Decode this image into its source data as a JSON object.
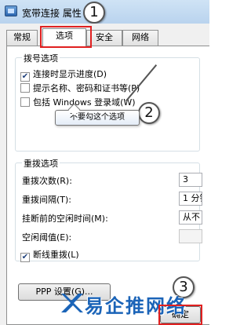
{
  "window": {
    "title": "宽带连接 属性"
  },
  "tabs": [
    {
      "label": "常规"
    },
    {
      "label": "选项"
    },
    {
      "label": "安全"
    },
    {
      "label": "网络"
    }
  ],
  "dial_options": {
    "group_title": "拨号选项",
    "show_progress": {
      "label": "连接时显示进度(D)",
      "checked": true
    },
    "prompt_credentials": {
      "label": "提示名称、密码和证书等(P)",
      "checked": false
    },
    "include_domain": {
      "label": "包括 Windows 登录域(W)",
      "checked": false
    },
    "include_domain_visible": "包括 Windows 登录域(W)"
  },
  "tooltip": {
    "text": "不要勾这个选项"
  },
  "redial_options": {
    "group_title": "重拨选项",
    "redial_attempts": {
      "label": "重拨次数(R):",
      "value": "3"
    },
    "redial_interval": {
      "label": "重拨间隔(T):",
      "value": "1 分钟"
    },
    "idle_hangup": {
      "label": "挂断前的空闲时间(M):",
      "value": "从不"
    },
    "idle_threshold": {
      "label": "空闲阈值(E):",
      "value": ""
    },
    "redial_if_dropped": {
      "label": "断线重拨(L)",
      "checked": true
    }
  },
  "ppp_button": {
    "label": "PPP 设置(G)..."
  },
  "ok_button": {
    "label": "确定"
  },
  "callouts": [
    "1",
    "2",
    "3"
  ],
  "watermark": {
    "text": "易企推网络"
  },
  "colors": {
    "highlight_red": "#e02020",
    "watermark_blue": "#1b64b8"
  }
}
